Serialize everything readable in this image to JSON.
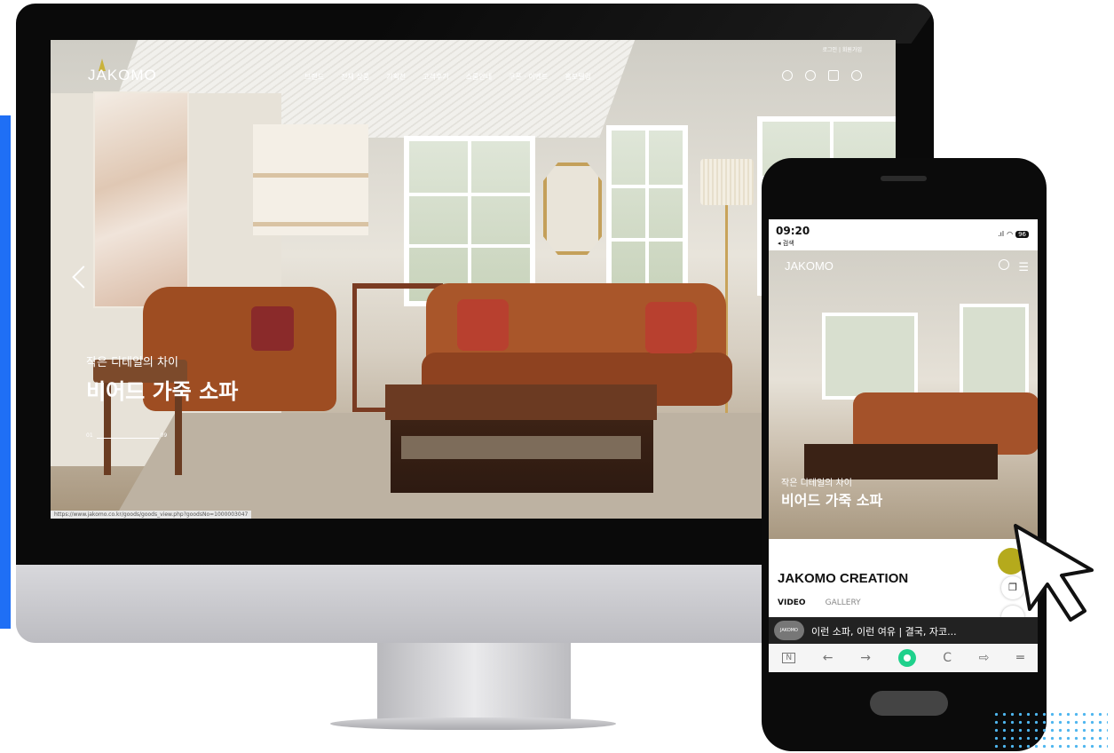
{
  "desktop": {
    "top_links": "로그인 | 회원가입",
    "logo": "JAKOMO",
    "nav_items": [
      "브랜드",
      "전체 상품",
      "기획전",
      "고객후기",
      "쇼룸안내",
      "쿠폰 · 이벤트",
      "홈모델링"
    ],
    "hero_subtitle": "작은 디테일의 차이",
    "hero_title": "비어드 가죽 소파",
    "pager_current": "01",
    "pager_total": "09",
    "status_url": "https://www.jakomo.co.kr/goods/goods_view.php?goodsNo=1000003047"
  },
  "mobile": {
    "time": "09:20",
    "back_label": "◂ 검색",
    "battery": "96",
    "logo": "JAKOMO",
    "hero_subtitle": "작은 디테일의 차이",
    "hero_title": "비어드 가죽 소파",
    "section_title": "JAKOMO CREATION",
    "tabs": [
      "VIDEO",
      "GALLERY"
    ],
    "video_channel": "JAKOMO",
    "video_title": "이런 소파, 이런 여유 | 결국, 자코...",
    "browser_bar": [
      "N",
      "←",
      "→",
      "C",
      "⇨",
      "═"
    ]
  },
  "colors": {
    "accent_blue": "#1f6ff5",
    "leather": "#a9562a",
    "naver_green": "#1fd18c",
    "dots": "#4fb6ef"
  }
}
